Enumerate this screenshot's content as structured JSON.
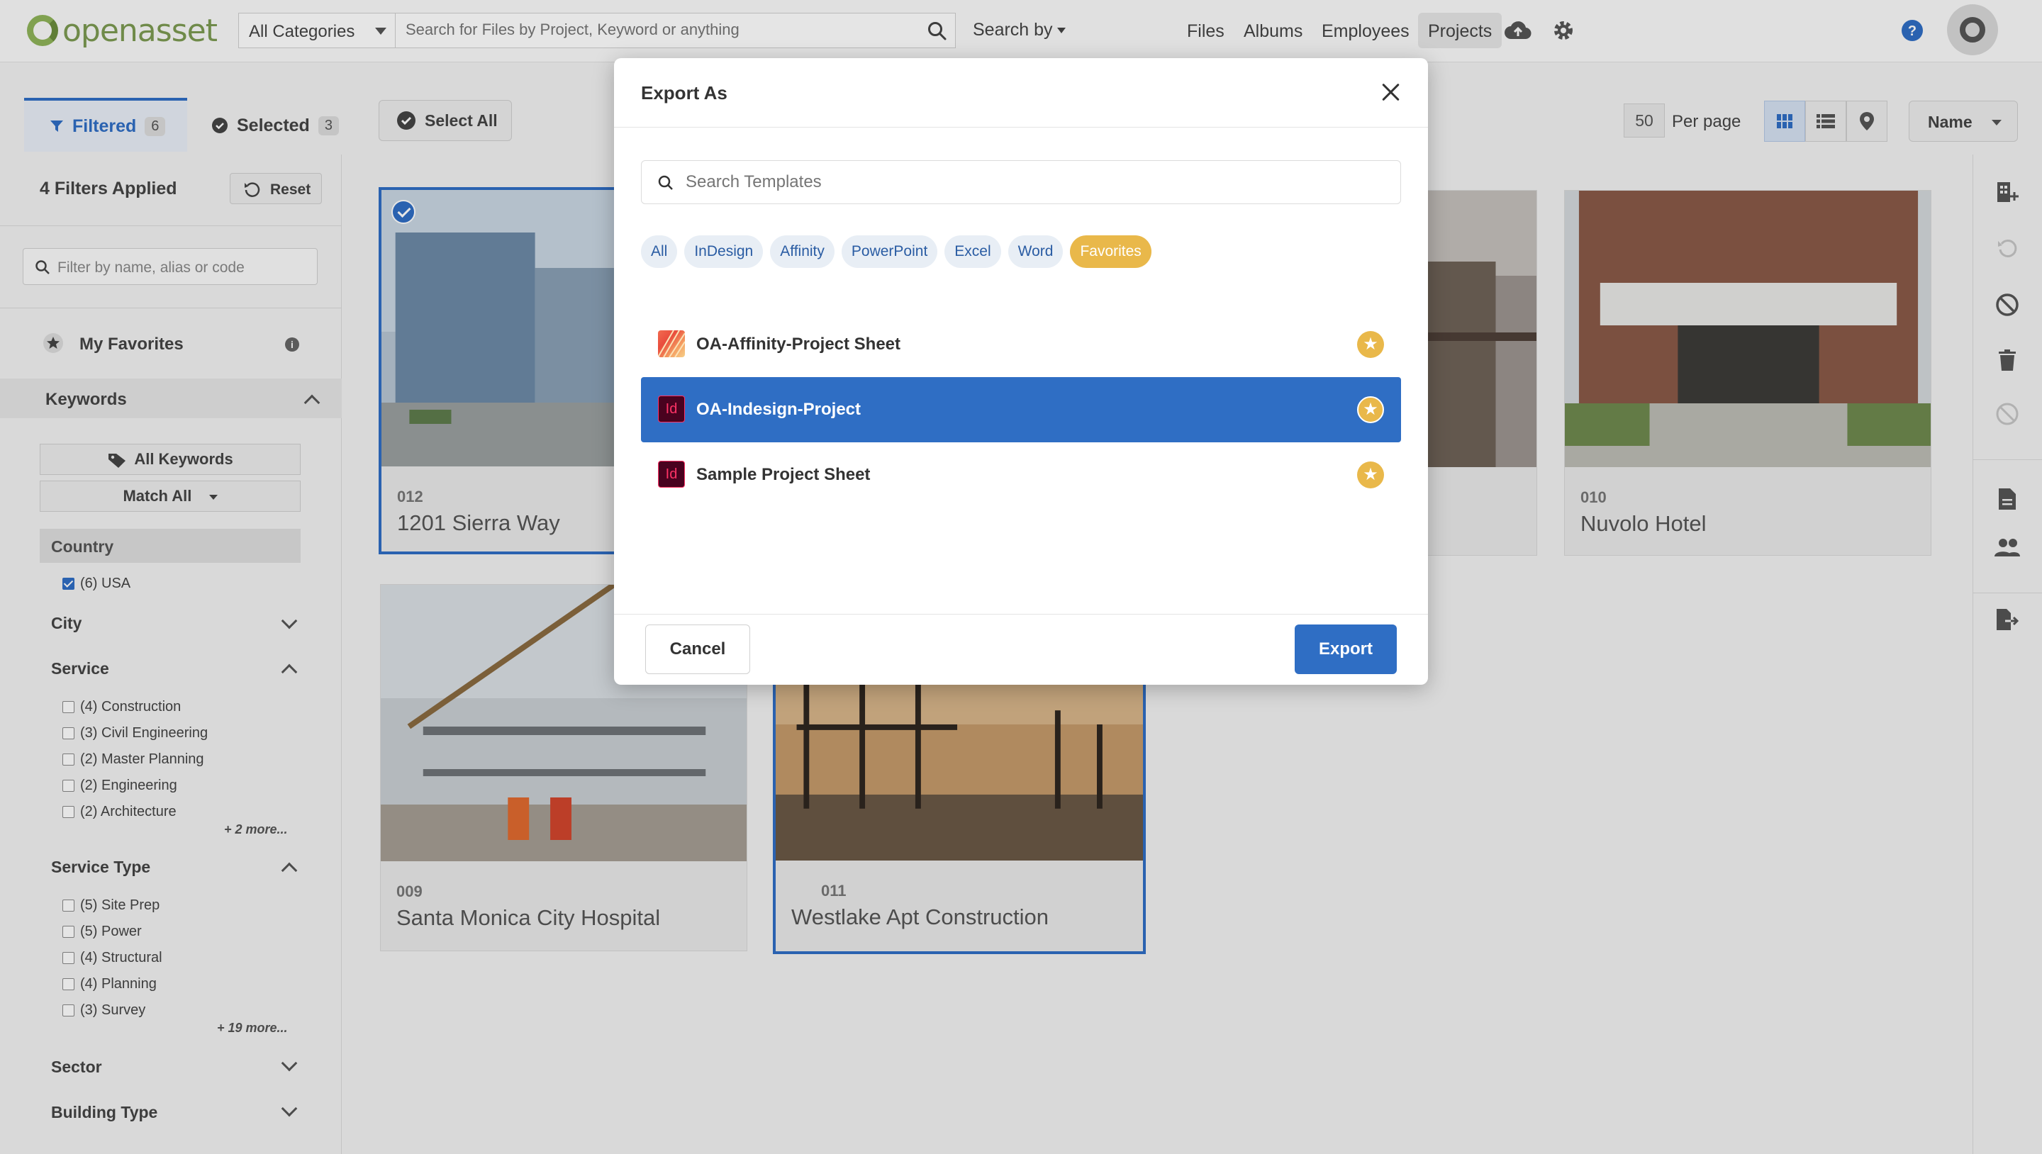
{
  "brand": {
    "logo_text": "openasset"
  },
  "topbar": {
    "category_select": "All Categories",
    "search_placeholder": "Search for Files by Project, Keyword or anything",
    "search_by": "Search by",
    "nav": [
      "Files",
      "Albums",
      "Employees",
      "Projects"
    ],
    "active_nav": "Projects"
  },
  "toolbar": {
    "tab_filtered_label": "Filtered",
    "tab_filtered_count": "6",
    "tab_selected_label": "Selected",
    "tab_selected_count": "3",
    "select_all": "Select All",
    "per_page_value": "50",
    "per_page_label": "Per page",
    "sort_label": "Name"
  },
  "sidebar": {
    "filters_applied": "4 Filters Applied",
    "reset": "Reset",
    "filter_placeholder": "Filter by name, alias or code",
    "my_favorites": "My Favorites",
    "keywords_heading": "Keywords",
    "all_keywords": "All Keywords",
    "match_all": "Match All",
    "country_heading": "Country",
    "country_items": [
      {
        "label": "(6) USA",
        "checked": true
      }
    ],
    "city_label": "City",
    "service_label": "Service",
    "service_items": [
      "(4) Construction",
      "(3) Civil Engineering",
      "(2) Master Planning",
      "(2) Engineering",
      "(2) Architecture"
    ],
    "service_more": "+ 2 more...",
    "service_type_label": "Service Type",
    "service_type_items": [
      "(5) Site Prep",
      "(5) Power",
      "(4) Structural",
      "(4) Planning",
      "(3) Survey"
    ],
    "service_type_more": "+ 19 more...",
    "sector_label": "Sector",
    "building_type_label": "Building Type"
  },
  "cards": [
    {
      "code": "012",
      "name": "1201 Sierra Way",
      "selected": true
    },
    {
      "code": "010",
      "name": "Nuvolo Hotel",
      "selected": false
    },
    {
      "code": "009",
      "name": "Santa Monica City Hospital",
      "selected": false
    },
    {
      "code": "011",
      "name": "Westlake Apt Construction",
      "selected": true
    }
  ],
  "modal": {
    "title": "Export As",
    "search_placeholder": "Search Templates",
    "filters": [
      "All",
      "InDesign",
      "Affinity",
      "PowerPoint",
      "Excel",
      "Word",
      "Favorites"
    ],
    "active_filter": "Favorites",
    "templates": [
      {
        "name": "OA-Affinity-Project Sheet",
        "app": "affinity",
        "favorite": true,
        "selected": false
      },
      {
        "name": "OA-Indesign-Project",
        "app": "indesign",
        "app_label": "Id",
        "favorite": true,
        "selected": true
      },
      {
        "name": "Sample Project Sheet",
        "app": "indesign",
        "app_label": "Id",
        "favorite": true,
        "selected": false
      }
    ],
    "cancel": "Cancel",
    "export": "Export"
  },
  "colors": {
    "accent": "#2f6ec4",
    "favorite": "#e9b84a",
    "brand_green": "#7c9a52"
  }
}
